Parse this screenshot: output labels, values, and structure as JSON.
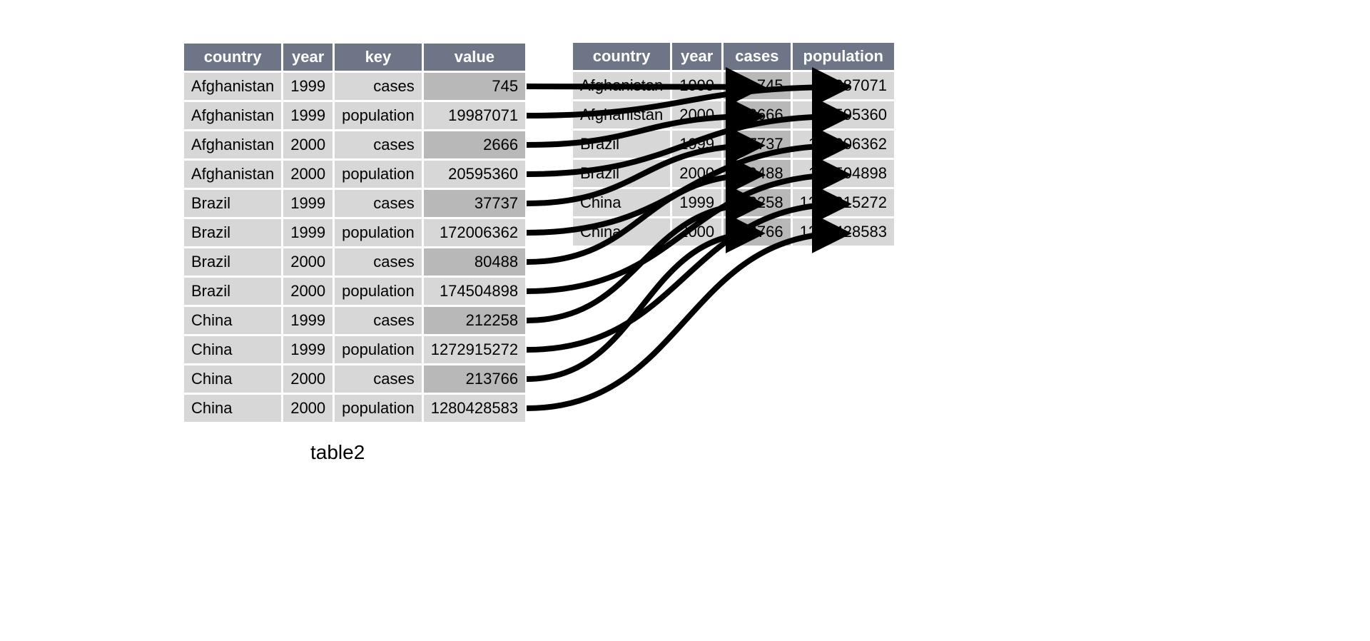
{
  "left": {
    "headers": [
      "country",
      "year",
      "key",
      "value"
    ],
    "rows": [
      {
        "country": "Afghanistan",
        "year": "1999",
        "key": "cases",
        "value": "745",
        "dark": true
      },
      {
        "country": "Afghanistan",
        "year": "1999",
        "key": "population",
        "value": "19987071",
        "dark": false
      },
      {
        "country": "Afghanistan",
        "year": "2000",
        "key": "cases",
        "value": "2666",
        "dark": true
      },
      {
        "country": "Afghanistan",
        "year": "2000",
        "key": "population",
        "value": "20595360",
        "dark": false
      },
      {
        "country": "Brazil",
        "year": "1999",
        "key": "cases",
        "value": "37737",
        "dark": true
      },
      {
        "country": "Brazil",
        "year": "1999",
        "key": "population",
        "value": "172006362",
        "dark": false
      },
      {
        "country": "Brazil",
        "year": "2000",
        "key": "cases",
        "value": "80488",
        "dark": true
      },
      {
        "country": "Brazil",
        "year": "2000",
        "key": "population",
        "value": "174504898",
        "dark": false
      },
      {
        "country": "China",
        "year": "1999",
        "key": "cases",
        "value": "212258",
        "dark": true
      },
      {
        "country": "China",
        "year": "1999",
        "key": "population",
        "value": "1272915272",
        "dark": false
      },
      {
        "country": "China",
        "year": "2000",
        "key": "cases",
        "value": "213766",
        "dark": true
      },
      {
        "country": "China",
        "year": "2000",
        "key": "population",
        "value": "1280428583",
        "dark": false
      }
    ],
    "caption": "table2"
  },
  "right": {
    "headers": [
      "country",
      "year",
      "cases",
      "population"
    ],
    "rows": [
      {
        "country": "Afghanistan",
        "year": "1999",
        "cases": "745",
        "population": "19987071"
      },
      {
        "country": "Afghanistan",
        "year": "2000",
        "cases": "2666",
        "population": "20595360"
      },
      {
        "country": "Brazil",
        "year": "1999",
        "cases": "37737",
        "population": "172006362"
      },
      {
        "country": "Brazil",
        "year": "2000",
        "cases": "80488",
        "population": "174504898"
      },
      {
        "country": "China",
        "year": "1999",
        "cases": "212258",
        "population": "1272915272"
      },
      {
        "country": "China",
        "year": "2000",
        "cases": "213766",
        "population": "1280428583"
      }
    ]
  },
  "arrows": {
    "from_left_row_to_right": [
      {
        "row": 0,
        "target": "cases",
        "rr": 0
      },
      {
        "row": 1,
        "target": "population",
        "rr": 0
      },
      {
        "row": 2,
        "target": "cases",
        "rr": 1
      },
      {
        "row": 3,
        "target": "population",
        "rr": 1
      },
      {
        "row": 4,
        "target": "cases",
        "rr": 2
      },
      {
        "row": 5,
        "target": "population",
        "rr": 2
      },
      {
        "row": 6,
        "target": "cases",
        "rr": 3
      },
      {
        "row": 7,
        "target": "population",
        "rr": 3
      },
      {
        "row": 8,
        "target": "cases",
        "rr": 4
      },
      {
        "row": 9,
        "target": "population",
        "rr": 4
      },
      {
        "row": 10,
        "target": "cases",
        "rr": 5
      },
      {
        "row": 11,
        "target": "population",
        "rr": 5
      }
    ]
  }
}
